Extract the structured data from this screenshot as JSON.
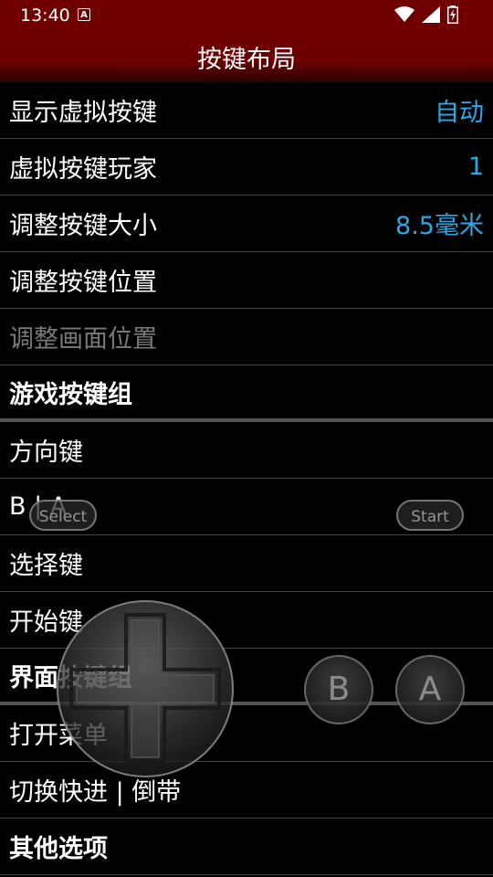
{
  "status_bar": {
    "time": "13:40",
    "notification_icon": "A",
    "icons": [
      "wifi-icon",
      "signal-icon",
      "battery-charging-icon"
    ]
  },
  "title_bar": {
    "title": "按键布局"
  },
  "settings": [
    {
      "label": "显示虚拟按键",
      "value": "自动",
      "type": "setting"
    },
    {
      "label": "虚拟按键玩家",
      "value": "1",
      "type": "setting"
    },
    {
      "label": "调整按键大小",
      "value": "8.5毫米",
      "type": "setting"
    },
    {
      "label": "调整按键位置",
      "value": "",
      "type": "setting"
    },
    {
      "label": "调整画面位置",
      "value": "",
      "type": "disabled"
    },
    {
      "label": "游戏按键组",
      "value": "",
      "type": "header"
    },
    {
      "label": "方向键",
      "value": "",
      "type": "setting"
    },
    {
      "label": "B | A",
      "value": "",
      "type": "setting"
    },
    {
      "label": "选择键",
      "value": "",
      "type": "setting"
    },
    {
      "label": "开始键",
      "value": "",
      "type": "setting"
    },
    {
      "label": "界面按键组",
      "value": "",
      "type": "header"
    },
    {
      "label": "打开菜单",
      "value": "",
      "type": "setting"
    },
    {
      "label": "切换快进 | 倒带",
      "value": "",
      "type": "setting"
    },
    {
      "label": "其他选项",
      "value": "",
      "type": "header"
    }
  ],
  "virtual_controls": {
    "select_label": "Select",
    "start_label": "Start",
    "b_label": "B",
    "a_label": "A"
  },
  "colors": {
    "status_bar": "#700000",
    "value_accent": "#2aa8e8",
    "disabled_text": "#7a7a7a"
  }
}
